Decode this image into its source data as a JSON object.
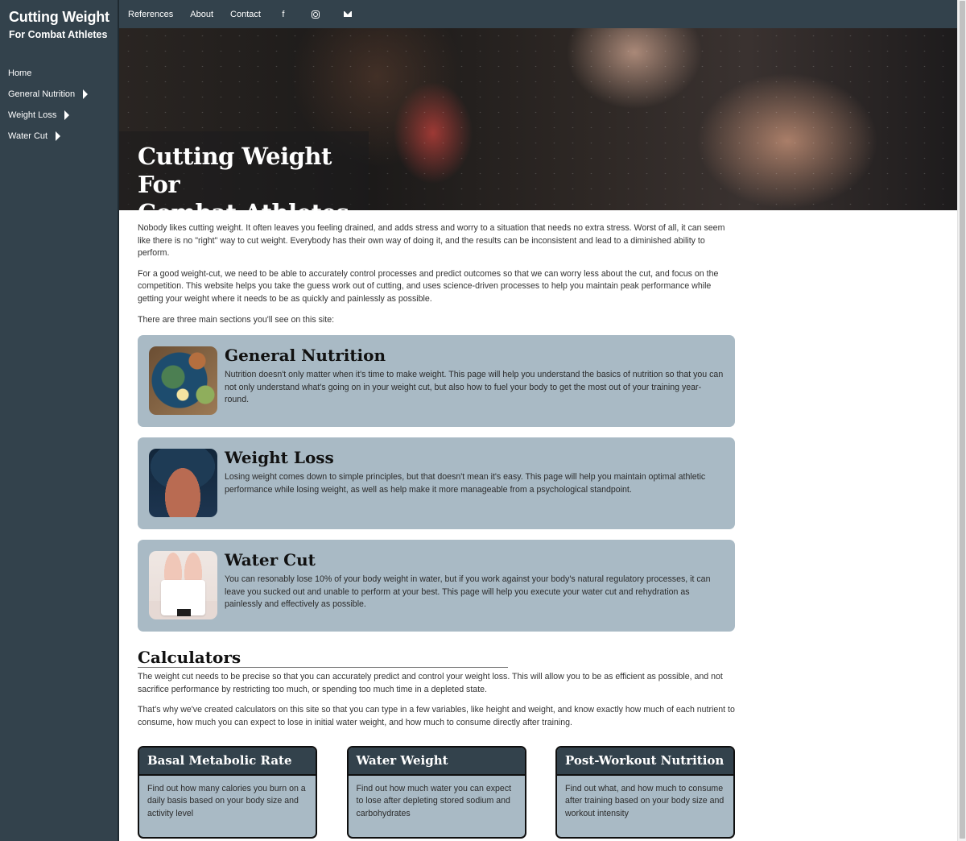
{
  "brand": {
    "title": "Cutting Weight",
    "subtitle": "For Combat Athletes"
  },
  "sidebar": {
    "items": [
      {
        "label": "Home",
        "has_submenu": false
      },
      {
        "label": "General Nutrition",
        "has_submenu": true
      },
      {
        "label": "Weight Loss",
        "has_submenu": true
      },
      {
        "label": "Water Cut",
        "has_submenu": true
      }
    ]
  },
  "topnav": {
    "links": [
      "References",
      "About",
      "Contact"
    ],
    "icons": [
      "facebook-icon",
      "instagram-icon",
      "mail-icon"
    ],
    "facebook_glyph": "f"
  },
  "hero": {
    "title_line1": "Cutting Weight For",
    "title_line2": "Combat Athletes"
  },
  "intro": {
    "p1": "Nobody likes cutting weight. It often leaves you feeling drained, and adds stress and worry to a situation that needs no extra stress. Worst of all, it can seem like there is no \"right\" way to cut weight. Everybody has their own way of doing it, and the results can be inconsistent and lead to a diminished ability to perform.",
    "p2": "For a good weight-cut, we need to be able to accurately control processes and predict outcomes so that we can worry less about the cut, and focus on the competition. This website helps you take the guess work out of cutting, and uses science-driven processes to help you maintain peak performance while getting your weight where it needs to be as quickly and painlessly as possible.",
    "p3": "There are three main sections you'll see on this site:"
  },
  "sections": [
    {
      "title": "General Nutrition",
      "text": "Nutrition doesn't only matter when it's time to make weight. This page will help you understand the basics of nutrition so that you can not only understand what's going on in your weight cut, but also how to fuel your body to get the most out of your training year-round."
    },
    {
      "title": "Weight Loss",
      "text": "Losing weight comes down to simple principles, but that doesn't mean it's easy. This page will help you maintain optimal athletic performance while losing weight, as well as help make it more manageable from a psychological standpoint."
    },
    {
      "title": "Water Cut",
      "text": "You can resonably lose 10% of your body weight in water, but if you work against your body's natural regulatory processes, it can leave you sucked out and unable to perform at your best. This page will help you execute your water cut and rehydration as painlessly and effectively as possible."
    }
  ],
  "calculators": {
    "heading": "Calculators",
    "p1": "The weight cut needs to be precise so that you can accurately predict and control your weight loss. This will allow you to be as efficient as possible, and not sacrifice performance by restricting too much, or spending too much time in a depleted state.",
    "p2": "That's why we've created calculators on this site so that you can type in a few variables, like height and weight, and know exactly how much of each nutrient to consume, how much you can expect to lose in initial water weight, and how much to consume directly after training.",
    "cards": [
      {
        "title": "Basal Metabolic Rate",
        "desc": "Find out how many calories you burn on a daily basis based on your body size and activity level"
      },
      {
        "title": "Water Weight",
        "desc": "Find out how much water you can expect to lose after depleting stored sodium and carbohydrates"
      },
      {
        "title": "Post-Workout Nutrition",
        "desc": "Find out what, and how much to consume after training based on your body size and workout intensity"
      }
    ]
  },
  "colors": {
    "nav_bg": "#33424c",
    "card_bg": "#a9bac5",
    "text": "#2b2b2b"
  }
}
